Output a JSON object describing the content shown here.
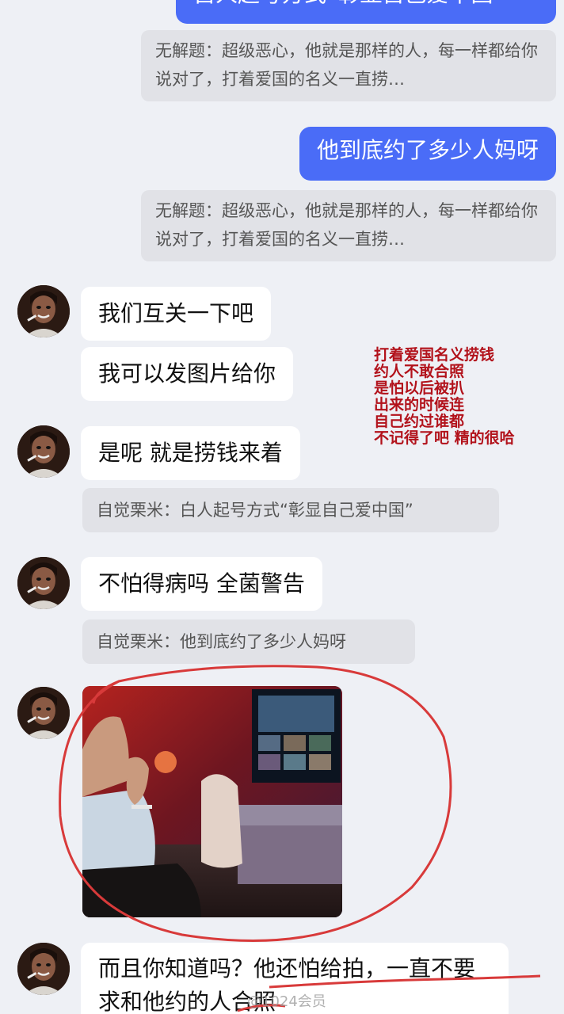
{
  "messages": {
    "out_top_partial": "自人起号方式“彰显自己爱中国”",
    "quote_1": "无解题：超级恶心，他就是那样的人，每一样都给你说对了，打着爱国的名义一直捞…",
    "out_1": "他到底约了多少人妈呀",
    "quote_2": "无解题：超级恶心，他就是那样的人，每一样都给你说对了，打着爱国的名义一直捞…",
    "in_1": "我们互关一下吧",
    "in_2": "我可以发图片给你",
    "in_3": "是呢 就是捞钱来着",
    "quote_3": "自觉栗米：白人起号方式“彰显自己爱中国”",
    "in_4": "不怕得病吗 全菌警告",
    "quote_4": "自觉栗米：他到底约了多少人妈呀",
    "in_5": "而且你知道吗？他还怕给拍，一直不要求和他约的人合照"
  },
  "annotation_lines": [
    "打着爱国名义捞钱",
    "约人不敢合照",
    "是怕以后被扒",
    "出来的时候连",
    "自己约过谁都",
    "不记得了吧 精的很哈"
  ],
  "watermark": "@1024会员",
  "colors": {
    "outgoing_bubble": "#4a6cf7",
    "incoming_bubble": "#ffffff",
    "quote_card": "#e1e2e7",
    "background": "#eef0f5",
    "annotation": "#b2121b"
  },
  "icons": {
    "avatar": "user-avatar-photo",
    "photo": "photo-message"
  }
}
